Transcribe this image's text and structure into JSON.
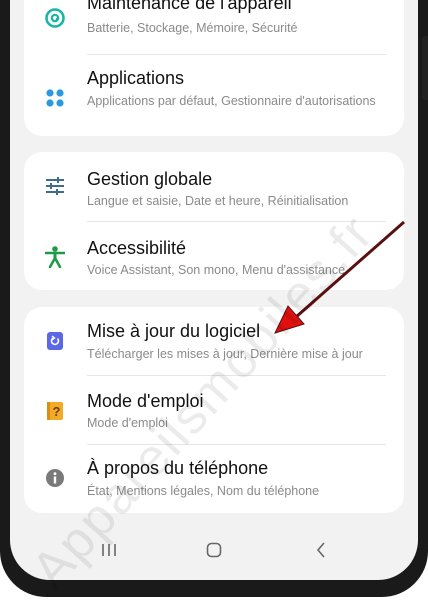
{
  "settings": {
    "items": [
      {
        "title": "Maintenance de l'appareil",
        "sub": "Batterie, Stockage, Mémoire, Sécurité",
        "icon": "device-care-icon"
      },
      {
        "title": "Applications",
        "sub": "Applications par défaut, Gestionnaire d'autorisations",
        "icon": "apps-icon"
      },
      {
        "title": "Gestion globale",
        "sub": "Langue et saisie, Date et heure, Réinitialisation",
        "icon": "sliders-icon"
      },
      {
        "title": "Accessibilité",
        "sub": "Voice Assistant, Son mono, Menu d'assistance",
        "icon": "accessibility-icon"
      },
      {
        "title": "Mise à jour du logiciel",
        "sub": "Télécharger les mises à jour, Dernière mise à jour",
        "icon": "software-update-icon"
      },
      {
        "title": "Mode d'emploi",
        "sub": "Mode d'emploi",
        "icon": "user-manual-icon"
      },
      {
        "title": "À propos du téléphone",
        "sub": "État, Mentions légales, Nom du téléphone",
        "icon": "info-icon"
      }
    ]
  },
  "watermark": "Appareilsmobiles.fr",
  "colors": {
    "teal": "#1ab5a6",
    "blue": "#2a9ae0",
    "slate": "#3d6c8c",
    "green": "#1f9a48",
    "indigo": "#5a68e6",
    "amber": "#f2aa27",
    "grey": "#7a7a7a",
    "arrow": "#e01010"
  }
}
